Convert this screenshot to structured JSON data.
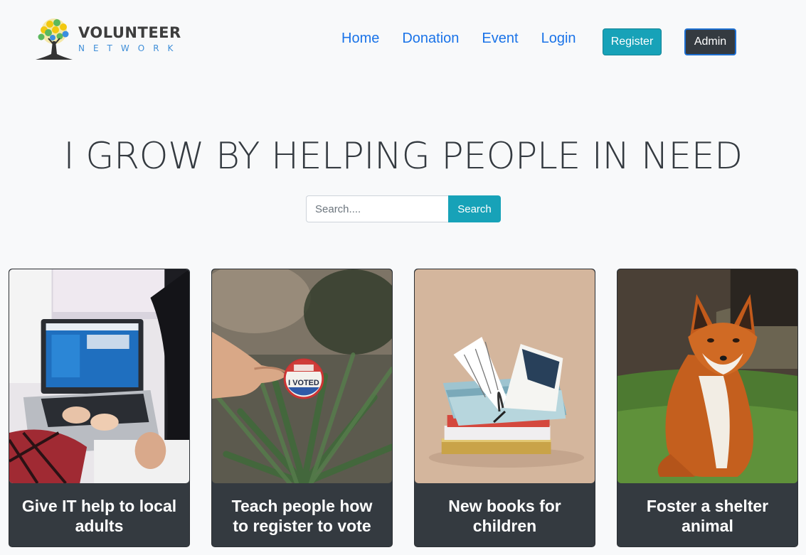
{
  "brand": {
    "title": "VOLUNTEER",
    "subtitle": "NETWORK",
    "icon": "tree-logo-icon",
    "colors": {
      "title": "#3d3d3d",
      "subtitle": "#3f8ed8",
      "leaves_yellow": "#f2c80f",
      "leaves_green": "#5cb85c",
      "leaves_blue": "#3b8ee0"
    }
  },
  "nav": {
    "links": [
      "Home",
      "Donation",
      "Event",
      "Login"
    ],
    "register_label": "Register",
    "admin_label": "Admin"
  },
  "hero": {
    "title": "I GROW BY HELPING PEOPLE IN NEED"
  },
  "search": {
    "placeholder": "Search....",
    "value": "",
    "button_label": "Search"
  },
  "cards": [
    {
      "title": "Give IT help to local adults",
      "image": "laptop-typing-photo"
    },
    {
      "title": "Teach people how to register to vote",
      "image": "i-voted-sticker-photo",
      "image_text": "I VOTED"
    },
    {
      "title": "New books for children",
      "image": "open-books-photo"
    },
    {
      "title": "Foster a shelter animal",
      "image": "red-fox-photo"
    }
  ],
  "colors": {
    "background": "#f8f9fa",
    "nav_link": "#1a73e8",
    "info": "#17a2b8",
    "dark": "#343a40"
  }
}
